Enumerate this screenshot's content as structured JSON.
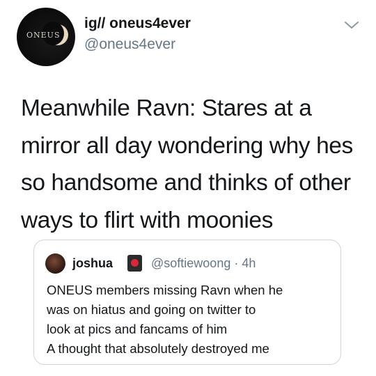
{
  "tweet": {
    "avatar_logo_text": "ONEUS",
    "display_name": "ig// oneus4ever",
    "handle": "@oneus4ever",
    "menu_icon": "chevron-down-icon",
    "text": "Meanwhile Ravn: Stares at a mirror all day wondering why hes so handsome and thinks of other ways to flirt with moonies"
  },
  "quoted_tweet": {
    "display_name": "joshua",
    "badge_icon": "red-dot-badge-icon",
    "handle_time": "@softiewoong · 4h",
    "lines": [
      "ONEUS members missing Ravn when he",
      "was on hiatus and going on twitter to",
      "look at pics and fancams of him",
      "A thought that absolutely destroyed me"
    ]
  },
  "colors": {
    "text": "#14171a",
    "secondary": "#657786",
    "border": "#ccd6dd",
    "chevron": "#8899a6"
  }
}
